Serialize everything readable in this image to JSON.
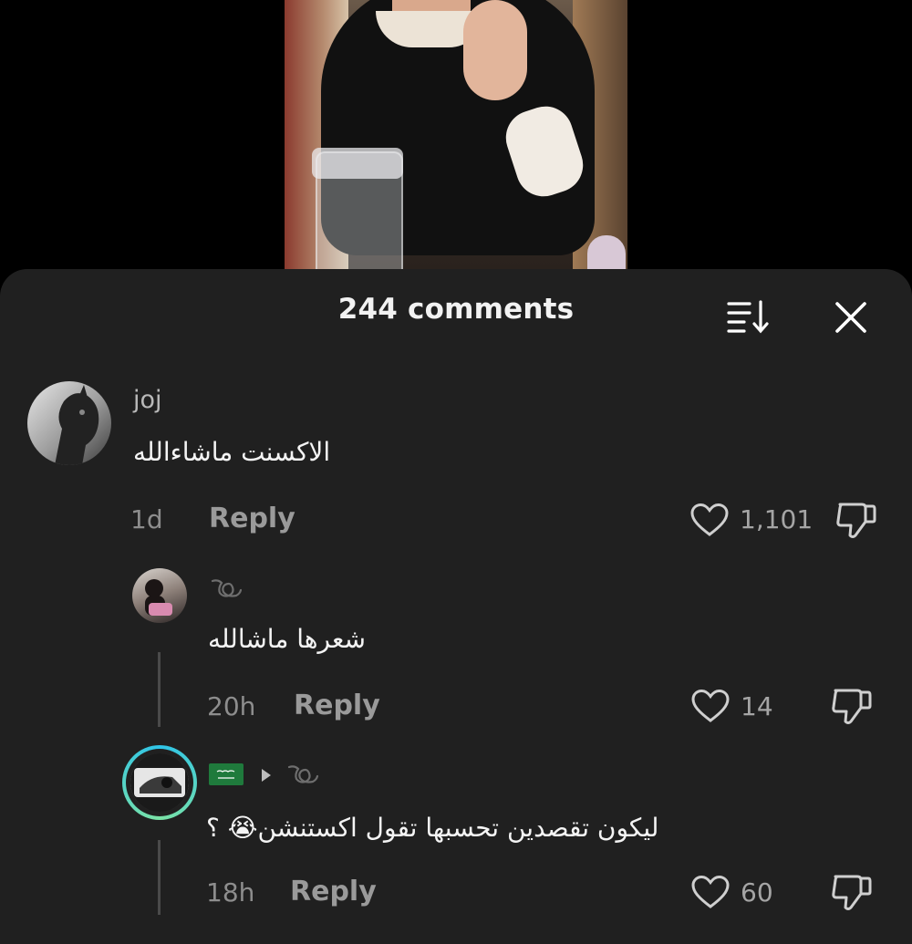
{
  "sheet": {
    "title": "244 comments"
  },
  "icons": {
    "sort": "sort-icon",
    "close": "close-icon",
    "like": "heart-outline-icon",
    "dislike": "thumbs-down-icon",
    "reply_to": "caret-right-icon",
    "name_glyph": "curl-glyph-icon",
    "flag": "saudi-flag-icon"
  },
  "comments": [
    {
      "username": "joj",
      "text": "الاكسنت ماشاءالله",
      "time": "1d",
      "reply_label": "Reply",
      "likes": "1,101"
    },
    {
      "username": "",
      "text": "شعرها ماشالله",
      "time": "20h",
      "reply_label": "Reply",
      "likes": "14"
    },
    {
      "username": "",
      "text": "ليكون تقصدين تحسبها تقول اكستنشن😭 ؟",
      "time": "18h",
      "reply_label": "Reply",
      "likes": "60"
    }
  ],
  "colors": {
    "sheet_bg": "#202020",
    "primary_text": "#f4f4f4",
    "secondary_text": "#9a9a9a",
    "story_ring_start": "#2ec4e8",
    "story_ring_end": "#7be3a6"
  }
}
